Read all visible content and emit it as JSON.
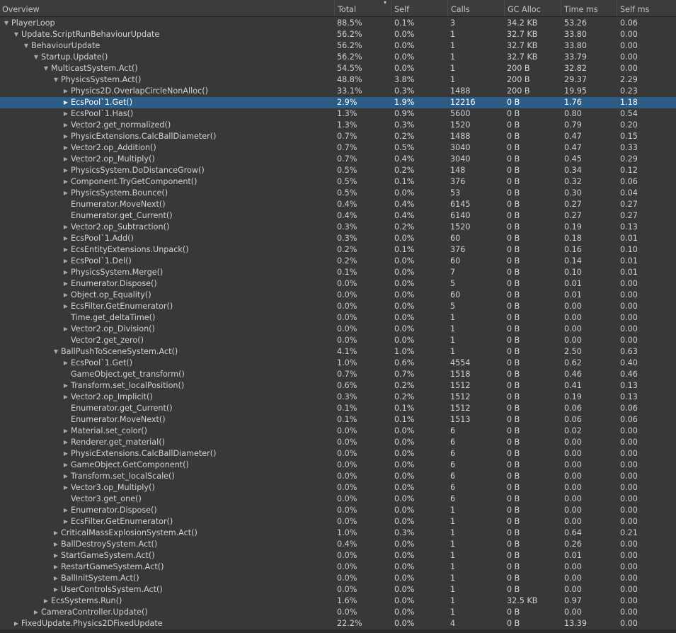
{
  "columns": {
    "overview": "Overview",
    "total": "Total",
    "self": "Self",
    "calls": "Calls",
    "gc_alloc": "GC Alloc",
    "time_ms": "Time ms",
    "self_ms": "Self ms",
    "sort_indicator": "▾"
  },
  "colors": {
    "selected_row": "#2c5d87",
    "background": "#383838",
    "text": "#d2d2d2"
  },
  "rows": [
    {
      "name": "PlayerLoop",
      "depth": 0,
      "exp": "open",
      "total": "88.5%",
      "self": "0.1%",
      "calls": "3",
      "gc": "34.2 KB",
      "time": "53.26",
      "selfms": "0.06"
    },
    {
      "name": "Update.ScriptRunBehaviourUpdate",
      "depth": 1,
      "exp": "open",
      "total": "56.2%",
      "self": "0.0%",
      "calls": "1",
      "gc": "32.7 KB",
      "time": "33.80",
      "selfms": "0.00"
    },
    {
      "name": "BehaviourUpdate",
      "depth": 2,
      "exp": "open",
      "total": "56.2%",
      "self": "0.0%",
      "calls": "1",
      "gc": "32.7 KB",
      "time": "33.80",
      "selfms": "0.00"
    },
    {
      "name": "Startup.Update()",
      "depth": 3,
      "exp": "open",
      "total": "56.2%",
      "self": "0.0%",
      "calls": "1",
      "gc": "32.7 KB",
      "time": "33.79",
      "selfms": "0.00"
    },
    {
      "name": "MulticastSystem.Act()",
      "depth": 4,
      "exp": "open",
      "total": "54.5%",
      "self": "0.0%",
      "calls": "1",
      "gc": "200 B",
      "time": "32.82",
      "selfms": "0.00"
    },
    {
      "name": "PhysicsSystem.Act()",
      "depth": 5,
      "exp": "open",
      "total": "48.8%",
      "self": "3.8%",
      "calls": "1",
      "gc": "200 B",
      "time": "29.37",
      "selfms": "2.29"
    },
    {
      "name": "Physics2D.OverlapCircleNonAlloc()",
      "depth": 6,
      "exp": "closed",
      "total": "33.1%",
      "self": "0.3%",
      "calls": "1488",
      "gc": "200 B",
      "time": "19.95",
      "selfms": "0.23"
    },
    {
      "name": "EcsPool`1.Get()",
      "depth": 6,
      "exp": "closed",
      "selected": true,
      "total": "2.9%",
      "self": "1.9%",
      "calls": "12216",
      "gc": "0 B",
      "time": "1.76",
      "selfms": "1.18"
    },
    {
      "name": "EcsPool`1.Has()",
      "depth": 6,
      "exp": "closed",
      "total": "1.3%",
      "self": "0.9%",
      "calls": "5600",
      "gc": "0 B",
      "time": "0.80",
      "selfms": "0.54"
    },
    {
      "name": "Vector2.get_normalized()",
      "depth": 6,
      "exp": "closed",
      "total": "1.3%",
      "self": "0.3%",
      "calls": "1520",
      "gc": "0 B",
      "time": "0.79",
      "selfms": "0.20"
    },
    {
      "name": "PhysicExtensions.CalcBallDiameter()",
      "depth": 6,
      "exp": "closed",
      "total": "0.7%",
      "self": "0.2%",
      "calls": "1488",
      "gc": "0 B",
      "time": "0.47",
      "selfms": "0.15"
    },
    {
      "name": "Vector2.op_Addition()",
      "depth": 6,
      "exp": "closed",
      "total": "0.7%",
      "self": "0.5%",
      "calls": "3040",
      "gc": "0 B",
      "time": "0.47",
      "selfms": "0.33"
    },
    {
      "name": "Vector2.op_Multiply()",
      "depth": 6,
      "exp": "closed",
      "total": "0.7%",
      "self": "0.4%",
      "calls": "3040",
      "gc": "0 B",
      "time": "0.45",
      "selfms": "0.29"
    },
    {
      "name": "PhysicsSystem.DoDistanceGrow()",
      "depth": 6,
      "exp": "closed",
      "total": "0.5%",
      "self": "0.2%",
      "calls": "148",
      "gc": "0 B",
      "time": "0.34",
      "selfms": "0.12"
    },
    {
      "name": "Component.TryGetComponent()",
      "depth": 6,
      "exp": "closed",
      "total": "0.5%",
      "self": "0.1%",
      "calls": "376",
      "gc": "0 B",
      "time": "0.32",
      "selfms": "0.06"
    },
    {
      "name": "PhysicsSystem.Bounce()",
      "depth": 6,
      "exp": "closed",
      "total": "0.5%",
      "self": "0.0%",
      "calls": "53",
      "gc": "0 B",
      "time": "0.30",
      "selfms": "0.04"
    },
    {
      "name": "Enumerator.MoveNext()",
      "depth": 6,
      "exp": "none",
      "total": "0.4%",
      "self": "0.4%",
      "calls": "6145",
      "gc": "0 B",
      "time": "0.27",
      "selfms": "0.27"
    },
    {
      "name": "Enumerator.get_Current()",
      "depth": 6,
      "exp": "none",
      "total": "0.4%",
      "self": "0.4%",
      "calls": "6140",
      "gc": "0 B",
      "time": "0.27",
      "selfms": "0.27"
    },
    {
      "name": "Vector2.op_Subtraction()",
      "depth": 6,
      "exp": "closed",
      "total": "0.3%",
      "self": "0.2%",
      "calls": "1520",
      "gc": "0 B",
      "time": "0.19",
      "selfms": "0.13"
    },
    {
      "name": "EcsPool`1.Add()",
      "depth": 6,
      "exp": "closed",
      "total": "0.3%",
      "self": "0.0%",
      "calls": "60",
      "gc": "0 B",
      "time": "0.18",
      "selfms": "0.01"
    },
    {
      "name": "EcsEntityExtensions.Unpack()",
      "depth": 6,
      "exp": "closed",
      "total": "0.2%",
      "self": "0.1%",
      "calls": "376",
      "gc": "0 B",
      "time": "0.16",
      "selfms": "0.10"
    },
    {
      "name": "EcsPool`1.Del()",
      "depth": 6,
      "exp": "closed",
      "total": "0.2%",
      "self": "0.0%",
      "calls": "60",
      "gc": "0 B",
      "time": "0.14",
      "selfms": "0.01"
    },
    {
      "name": "PhysicsSystem.Merge()",
      "depth": 6,
      "exp": "closed",
      "total": "0.1%",
      "self": "0.0%",
      "calls": "7",
      "gc": "0 B",
      "time": "0.10",
      "selfms": "0.01"
    },
    {
      "name": "Enumerator.Dispose()",
      "depth": 6,
      "exp": "closed",
      "total": "0.0%",
      "self": "0.0%",
      "calls": "5",
      "gc": "0 B",
      "time": "0.01",
      "selfms": "0.00"
    },
    {
      "name": "Object.op_Equality()",
      "depth": 6,
      "exp": "closed",
      "total": "0.0%",
      "self": "0.0%",
      "calls": "60",
      "gc": "0 B",
      "time": "0.01",
      "selfms": "0.00"
    },
    {
      "name": "EcsFilter.GetEnumerator()",
      "depth": 6,
      "exp": "closed",
      "total": "0.0%",
      "self": "0.0%",
      "calls": "5",
      "gc": "0 B",
      "time": "0.00",
      "selfms": "0.00"
    },
    {
      "name": "Time.get_deltaTime()",
      "depth": 6,
      "exp": "none",
      "total": "0.0%",
      "self": "0.0%",
      "calls": "1",
      "gc": "0 B",
      "time": "0.00",
      "selfms": "0.00"
    },
    {
      "name": "Vector2.op_Division()",
      "depth": 6,
      "exp": "closed",
      "total": "0.0%",
      "self": "0.0%",
      "calls": "1",
      "gc": "0 B",
      "time": "0.00",
      "selfms": "0.00"
    },
    {
      "name": "Vector2.get_zero()",
      "depth": 6,
      "exp": "none",
      "total": "0.0%",
      "self": "0.0%",
      "calls": "1",
      "gc": "0 B",
      "time": "0.00",
      "selfms": "0.00"
    },
    {
      "name": "BallPushToSceneSystem.Act()",
      "depth": 5,
      "exp": "open",
      "total": "4.1%",
      "self": "1.0%",
      "calls": "1",
      "gc": "0 B",
      "time": "2.50",
      "selfms": "0.63"
    },
    {
      "name": "EcsPool`1.Get()",
      "depth": 6,
      "exp": "closed",
      "total": "1.0%",
      "self": "0.6%",
      "calls": "4554",
      "gc": "0 B",
      "time": "0.62",
      "selfms": "0.40"
    },
    {
      "name": "GameObject.get_transform()",
      "depth": 6,
      "exp": "none",
      "total": "0.7%",
      "self": "0.7%",
      "calls": "1518",
      "gc": "0 B",
      "time": "0.46",
      "selfms": "0.46"
    },
    {
      "name": "Transform.set_localPosition()",
      "depth": 6,
      "exp": "closed",
      "total": "0.6%",
      "self": "0.2%",
      "calls": "1512",
      "gc": "0 B",
      "time": "0.41",
      "selfms": "0.13"
    },
    {
      "name": "Vector2.op_Implicit()",
      "depth": 6,
      "exp": "closed",
      "total": "0.3%",
      "self": "0.2%",
      "calls": "1512",
      "gc": "0 B",
      "time": "0.19",
      "selfms": "0.13"
    },
    {
      "name": "Enumerator.get_Current()",
      "depth": 6,
      "exp": "none",
      "total": "0.1%",
      "self": "0.1%",
      "calls": "1512",
      "gc": "0 B",
      "time": "0.06",
      "selfms": "0.06"
    },
    {
      "name": "Enumerator.MoveNext()",
      "depth": 6,
      "exp": "none",
      "total": "0.1%",
      "self": "0.1%",
      "calls": "1513",
      "gc": "0 B",
      "time": "0.06",
      "selfms": "0.06"
    },
    {
      "name": "Material.set_color()",
      "depth": 6,
      "exp": "closed",
      "total": "0.0%",
      "self": "0.0%",
      "calls": "6",
      "gc": "0 B",
      "time": "0.02",
      "selfms": "0.00"
    },
    {
      "name": "Renderer.get_material()",
      "depth": 6,
      "exp": "closed",
      "total": "0.0%",
      "self": "0.0%",
      "calls": "6",
      "gc": "0 B",
      "time": "0.00",
      "selfms": "0.00"
    },
    {
      "name": "PhysicExtensions.CalcBallDiameter()",
      "depth": 6,
      "exp": "closed",
      "total": "0.0%",
      "self": "0.0%",
      "calls": "6",
      "gc": "0 B",
      "time": "0.00",
      "selfms": "0.00"
    },
    {
      "name": "GameObject.GetComponent()",
      "depth": 6,
      "exp": "closed",
      "total": "0.0%",
      "self": "0.0%",
      "calls": "6",
      "gc": "0 B",
      "time": "0.00",
      "selfms": "0.00"
    },
    {
      "name": "Transform.set_localScale()",
      "depth": 6,
      "exp": "closed",
      "total": "0.0%",
      "self": "0.0%",
      "calls": "6",
      "gc": "0 B",
      "time": "0.00",
      "selfms": "0.00"
    },
    {
      "name": "Vector3.op_Multiply()",
      "depth": 6,
      "exp": "closed",
      "total": "0.0%",
      "self": "0.0%",
      "calls": "6",
      "gc": "0 B",
      "time": "0.00",
      "selfms": "0.00"
    },
    {
      "name": "Vector3.get_one()",
      "depth": 6,
      "exp": "none",
      "total": "0.0%",
      "self": "0.0%",
      "calls": "6",
      "gc": "0 B",
      "time": "0.00",
      "selfms": "0.00"
    },
    {
      "name": "Enumerator.Dispose()",
      "depth": 6,
      "exp": "closed",
      "total": "0.0%",
      "self": "0.0%",
      "calls": "1",
      "gc": "0 B",
      "time": "0.00",
      "selfms": "0.00"
    },
    {
      "name": "EcsFilter.GetEnumerator()",
      "depth": 6,
      "exp": "closed",
      "total": "0.0%",
      "self": "0.0%",
      "calls": "1",
      "gc": "0 B",
      "time": "0.00",
      "selfms": "0.00"
    },
    {
      "name": "CriticalMassExplosionSystem.Act()",
      "depth": 5,
      "exp": "closed",
      "total": "1.0%",
      "self": "0.3%",
      "calls": "1",
      "gc": "0 B",
      "time": "0.64",
      "selfms": "0.21"
    },
    {
      "name": "BallDestroySystem.Act()",
      "depth": 5,
      "exp": "closed",
      "total": "0.4%",
      "self": "0.0%",
      "calls": "1",
      "gc": "0 B",
      "time": "0.26",
      "selfms": "0.00"
    },
    {
      "name": "StartGameSystem.Act()",
      "depth": 5,
      "exp": "closed",
      "total": "0.0%",
      "self": "0.0%",
      "calls": "1",
      "gc": "0 B",
      "time": "0.01",
      "selfms": "0.00"
    },
    {
      "name": "RestartGameSystem.Act()",
      "depth": 5,
      "exp": "closed",
      "total": "0.0%",
      "self": "0.0%",
      "calls": "1",
      "gc": "0 B",
      "time": "0.00",
      "selfms": "0.00"
    },
    {
      "name": "BallInitSystem.Act()",
      "depth": 5,
      "exp": "closed",
      "total": "0.0%",
      "self": "0.0%",
      "calls": "1",
      "gc": "0 B",
      "time": "0.00",
      "selfms": "0.00"
    },
    {
      "name": "UserControlsSystem.Act()",
      "depth": 5,
      "exp": "closed",
      "total": "0.0%",
      "self": "0.0%",
      "calls": "1",
      "gc": "0 B",
      "time": "0.00",
      "selfms": "0.00"
    },
    {
      "name": "EcsSystems.Run()",
      "depth": 4,
      "exp": "closed",
      "total": "1.6%",
      "self": "0.0%",
      "calls": "1",
      "gc": "32.5 KB",
      "time": "0.97",
      "selfms": "0.00"
    },
    {
      "name": "CameraController.Update()",
      "depth": 3,
      "exp": "closed",
      "total": "0.0%",
      "self": "0.0%",
      "calls": "1",
      "gc": "0 B",
      "time": "0.00",
      "selfms": "0.00"
    },
    {
      "name": "FixedUpdate.Physics2DFixedUpdate",
      "depth": 1,
      "exp": "closed",
      "total": "22.2%",
      "self": "0.0%",
      "calls": "4",
      "gc": "0 B",
      "time": "13.39",
      "selfms": "0.00"
    }
  ]
}
